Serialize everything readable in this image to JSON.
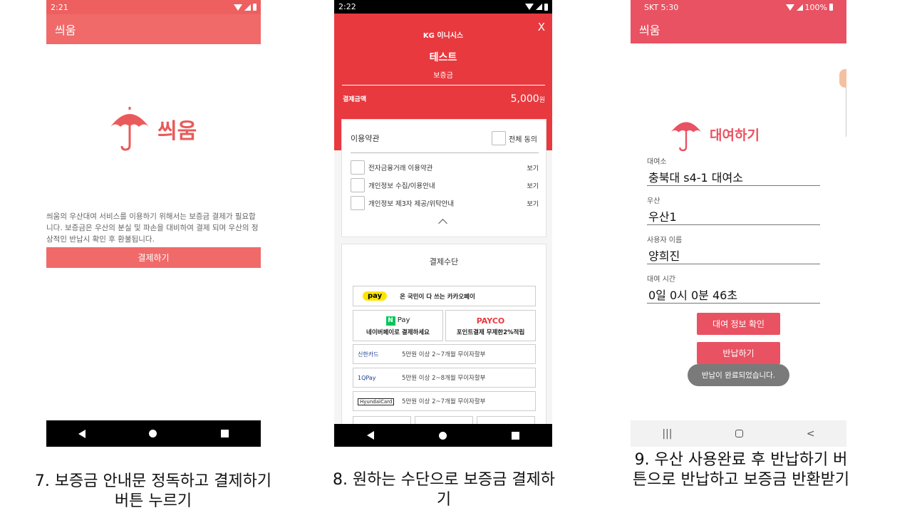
{
  "phone1": {
    "status_time": "2:21",
    "app_title": "씌움",
    "logo_text": "씌움",
    "notice": "씌움의 우산대여 서비스를 이용하기 위해서는 보증금 결제가 필요합니다. 보증금은 우산의 분실 및 파손을 대비하여 결제 되며 우산의 정상적인 반납시 확인 후 환불됩니다.",
    "pay_button": "결제하기",
    "caption": "7. 보증금 안내문 정독하고 결제하기 버튼 누르기",
    "accent": "#f06a6a"
  },
  "phone2": {
    "status_time": "2:22",
    "pg_logo": "KG 이니시스",
    "close": "X",
    "title": "테스트",
    "subtitle": "보증금",
    "amount_label": "결제금액",
    "amount_value": "5,000",
    "amount_unit": "원",
    "terms_title": "이용약관",
    "agree_all": "전체 동의",
    "terms": [
      {
        "label": "전자금융거래 이용약관",
        "view": "보기"
      },
      {
        "label": "개인정보 수집/이용안내",
        "view": "보기"
      },
      {
        "label": "개인정보 제3자 제공/위탁안내",
        "view": "보기"
      }
    ],
    "methods_title": "결제수단",
    "kakao_badge": "pay",
    "kakao_label": "온 국민이 다 쓰는 카카오페이",
    "naver_badge": "N",
    "naver_logo": "Pay",
    "naver_label": "네이버페이로 결제하세요",
    "payco_logo": "PAYCO",
    "payco_label": "포인트결제 무제한2%적립",
    "cards": [
      {
        "brand": "신한카드",
        "label": "5만원 이상 2~7개월 무이자할부"
      },
      {
        "brand": "1QPay",
        "label": "5만원 이상 2~8개월 무이자할부"
      },
      {
        "brand": "HyundaiCard",
        "label": "5만원 이상 2~7개월 무이자할부"
      }
    ],
    "caption": "8. 원하는 수단으로 보증금 결제하기",
    "accent": "#e8393f"
  },
  "phone3": {
    "status_left": "SKT 5:30",
    "status_right": "100%",
    "app_title": "씌움",
    "logo_text": "대여하기",
    "fields": [
      {
        "label": "대여소",
        "value": "충북대 s4-1 대여소"
      },
      {
        "label": "우산",
        "value": "우산1"
      },
      {
        "label": "사용자 이름",
        "value": "양희진"
      },
      {
        "label": "대여 시간",
        "value": "0일 0시 0분 46초"
      }
    ],
    "info_button": "대여 정보 확인",
    "return_button": "반납하기",
    "toast": "반납이 완료되었습니다.",
    "caption": "9. 우산 사용완료 후 반납하기 버튼으로 반납하고 보증금 반환받기",
    "accent": "#e95262"
  }
}
